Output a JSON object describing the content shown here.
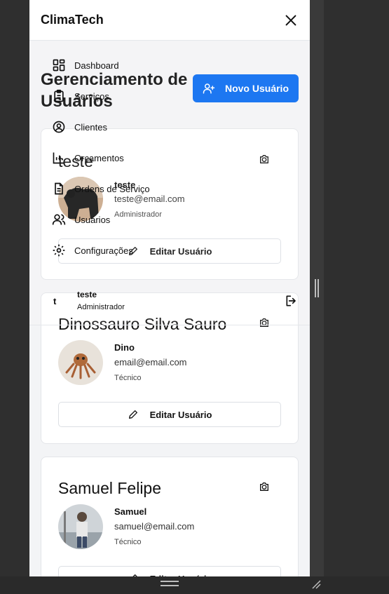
{
  "app": {
    "brand": "ClimaTech"
  },
  "page": {
    "title": "Gerenciamento de Usuários",
    "new_user_label": "Novo Usuário",
    "edit_label": "Editar Usuário"
  },
  "users": [
    {
      "name": "teste",
      "nick": "teste",
      "email": "teste@email.com",
      "role": "Administrador"
    },
    {
      "name": "Dinossauro Silva Sauro",
      "nick": "Dino",
      "email": "email@email.com",
      "role": "Técnico"
    },
    {
      "name": "Samuel Felipe",
      "nick": "Samuel",
      "email": "samuel@email.com",
      "role": "Técnico"
    }
  ],
  "sidebar": {
    "items": [
      {
        "label": "Dashboard",
        "icon": "dashboard-icon"
      },
      {
        "label": "Serviços",
        "icon": "clipboard-icon"
      },
      {
        "label": "Clientes",
        "icon": "user-circle-icon"
      },
      {
        "label": "Orçamentos",
        "icon": "bar-chart-icon"
      },
      {
        "label": "Ordens de Serviço",
        "icon": "document-icon"
      },
      {
        "label": "Usuários",
        "icon": "users-icon"
      },
      {
        "label": "Configurações",
        "icon": "gear-icon"
      }
    ],
    "user": {
      "initial": "t",
      "name": "teste",
      "role": "Administrador"
    }
  },
  "colors": {
    "primary": "#0a6cf0",
    "frame_bg": "#f3f4f6",
    "dark_bg": "#2f2f2f"
  }
}
